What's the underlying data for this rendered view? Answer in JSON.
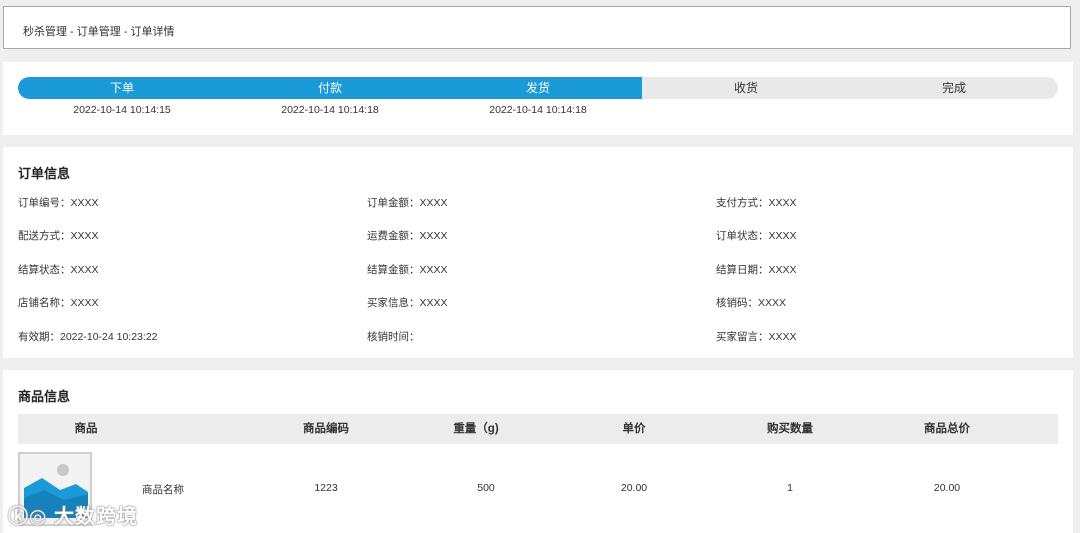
{
  "breadcrumb": "秒杀管理 - 订单管理 - 订单详情",
  "steps": [
    {
      "label": "下单",
      "time": "2022-10-14 10:14:15",
      "done": true
    },
    {
      "label": "付款",
      "time": "2022-10-14 10:14:18",
      "done": true
    },
    {
      "label": "发货",
      "time": "2022-10-14 10:14:18",
      "done": true
    },
    {
      "label": "收货",
      "time": "",
      "done": false
    },
    {
      "label": "完成",
      "time": "",
      "done": false
    }
  ],
  "order_info": {
    "title": "订单信息",
    "items": [
      [
        "订单编号：XXXX",
        "订单金额：XXXX",
        "支付方式：XXXX"
      ],
      [
        "配送方式：XXXX",
        "运费金额：XXXX",
        "订单状态：XXXX"
      ],
      [
        "结算状态：XXXX",
        "结算金额：XXXX",
        "结算日期：XXXX"
      ],
      [
        "店铺名称：XXXX",
        "买家信息：XXXX",
        "核销码：XXXX"
      ],
      [
        "有效期：2022-10-24 10:23:22",
        "核销时间：",
        "买家留言：XXXX"
      ]
    ]
  },
  "goods_info": {
    "title": "商品信息",
    "headers": [
      "商品",
      "商品编码",
      "重量（g)",
      "单价",
      "购买数量",
      "商品总价"
    ],
    "rows": [
      {
        "name": "商品名称",
        "code": "1223",
        "weight": "500",
        "price": "20.00",
        "qty": "1",
        "total": "20.00",
        "thumb_icon": "image-placeholder-icon"
      }
    ]
  },
  "watermark": "大数跨境",
  "colors": {
    "accent": "#1a9ad6",
    "track": "#e9e9e9",
    "panel": "#ffffff",
    "background": "#efefef"
  }
}
